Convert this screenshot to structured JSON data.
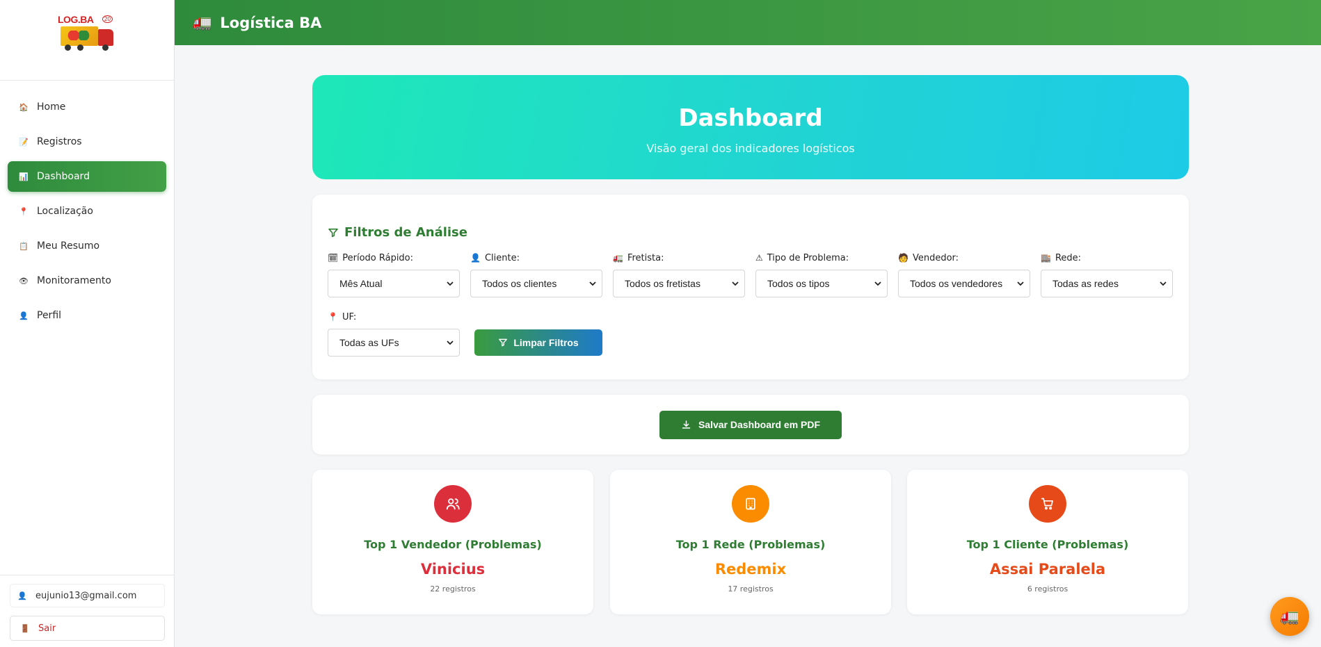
{
  "logo": {
    "text": "LOG.BA",
    "badge": "20"
  },
  "header": {
    "title": "Logística BA",
    "icon": "truck-icon"
  },
  "sidebar": {
    "items": [
      {
        "label": "Home",
        "icon": "house-icon",
        "emoji": "🏠"
      },
      {
        "label": "Registros",
        "icon": "memo-icon",
        "emoji": "📝"
      },
      {
        "label": "Dashboard",
        "icon": "bar-chart-icon",
        "emoji": "📊"
      },
      {
        "label": "Localização",
        "icon": "pin-icon",
        "emoji": "📍"
      },
      {
        "label": "Meu Resumo",
        "icon": "clipboard-icon",
        "emoji": "📋"
      },
      {
        "label": "Monitoramento",
        "icon": "eye-icon",
        "emoji": "👁"
      },
      {
        "label": "Perfil",
        "icon": "user-icon",
        "emoji": "👤"
      }
    ],
    "active_index": 2,
    "user_email": "eujunio13@gmail.com",
    "logout_label": "Sair"
  },
  "hero": {
    "title": "Dashboard",
    "subtitle": "Visão geral dos indicadores logísticos"
  },
  "filters": {
    "title": "Filtros de Análise",
    "fields": [
      {
        "label": "Período Rápido:",
        "emoji": "🗓",
        "value": "Mês Atual"
      },
      {
        "label": "Cliente:",
        "emoji": "👤",
        "value": "Todos os clientes"
      },
      {
        "label": "Fretista:",
        "emoji": "🚛",
        "value": "Todos os fretistas"
      },
      {
        "label": "Tipo de Problema:",
        "emoji": "⚠",
        "value": "Todos os tipos"
      },
      {
        "label": "Vendedor:",
        "emoji": "🧑",
        "value": "Todos os vendedores"
      },
      {
        "label": "Rede:",
        "emoji": "🏬",
        "value": "Todas as redes"
      },
      {
        "label": "UF:",
        "emoji": "📍",
        "value": "Todas as UFs"
      }
    ],
    "clear_label": "Limpar Filtros"
  },
  "pdf_button": {
    "label": "Salvar Dashboard em PDF"
  },
  "stats": [
    {
      "title": "Top 1 Vendedor (Problemas)",
      "value": "Vinicius",
      "sub": "22 registros",
      "color": "#dc2f3c",
      "icon": "users-icon"
    },
    {
      "title": "Top 1 Rede (Problemas)",
      "value": "Redemix",
      "sub": "17 registros",
      "color": "#fb8c00",
      "icon": "building-icon"
    },
    {
      "title": "Top 1 Cliente (Problemas)",
      "value": "Assai Paralela",
      "sub": "6 registros",
      "color": "#e64a19",
      "icon": "cart-icon"
    }
  ],
  "colors": {
    "primary": "#2e7d32",
    "hero_start": "#1ee8b8",
    "hero_end": "#1ecbe6"
  }
}
